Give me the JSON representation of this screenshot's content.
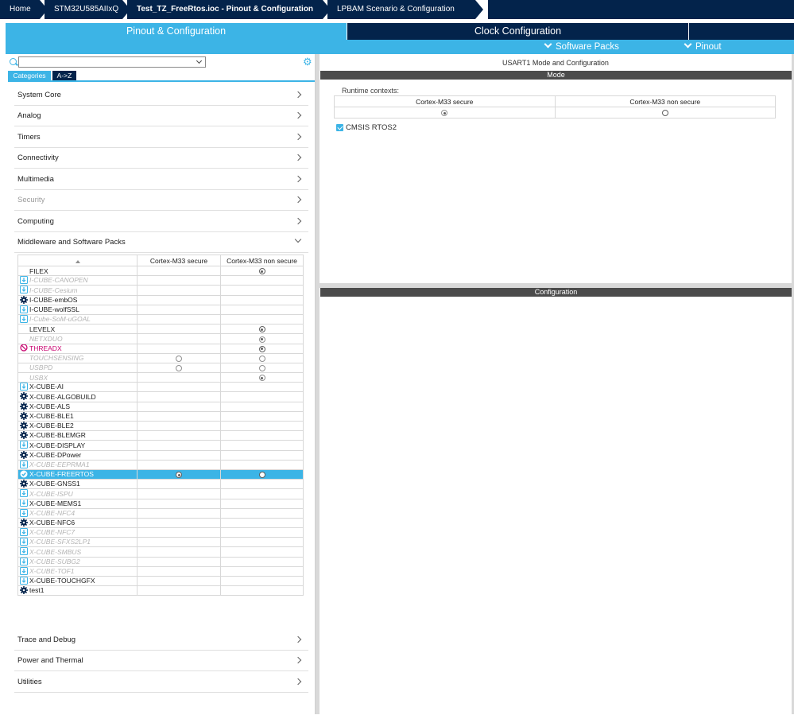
{
  "breadcrumb": [
    {
      "label": "Home",
      "active": false
    },
    {
      "label": "STM32U585AIIxQ",
      "active": false
    },
    {
      "label": "Test_TZ_FreeRtos.ioc - Pinout & Configuration",
      "active": true
    },
    {
      "label": "LPBAM Scenario & Configuration",
      "active": false
    }
  ],
  "tabs": {
    "pinout": "Pinout & Configuration",
    "clock": "Clock Configuration"
  },
  "submenus": {
    "software_packs": "Software Packs",
    "pinout": "Pinout"
  },
  "left": {
    "search_value": "",
    "view_tabs": {
      "categories": "Categories",
      "az": "A->Z"
    },
    "categories": [
      {
        "label": "System Core",
        "disabled": false
      },
      {
        "label": "Analog",
        "disabled": false
      },
      {
        "label": "Timers",
        "disabled": false
      },
      {
        "label": "Connectivity",
        "disabled": false
      },
      {
        "label": "Multimedia",
        "disabled": false
      },
      {
        "label": "Security",
        "disabled": true
      },
      {
        "label": "Computing",
        "disabled": false
      },
      {
        "label": "Middleware and Software Packs",
        "disabled": false,
        "expanded": true
      }
    ],
    "bottom_categories": [
      {
        "label": "Trace and Debug"
      },
      {
        "label": "Power and Thermal"
      },
      {
        "label": "Utilities"
      }
    ],
    "middleware_table": {
      "columns": [
        "Cortex-M33 secure",
        "Cortex-M33 non secure"
      ],
      "rows": [
        {
          "name": "FILEX",
          "icon": "none",
          "disabled": false,
          "secure": "",
          "nonsecure": "on"
        },
        {
          "name": "I-CUBE-CANOPEN",
          "icon": "download",
          "disabled": true,
          "secure": "",
          "nonsecure": ""
        },
        {
          "name": "I-CUBE-Cesium",
          "icon": "download",
          "disabled": true,
          "secure": "",
          "nonsecure": ""
        },
        {
          "name": "I-CUBE-embOS",
          "icon": "gear",
          "disabled": false,
          "secure": "",
          "nonsecure": ""
        },
        {
          "name": "I-CUBE-wolfSSL",
          "icon": "download",
          "disabled": false,
          "secure": "",
          "nonsecure": ""
        },
        {
          "name": "I-Cube-SoM-uGOAL",
          "icon": "download",
          "disabled": true,
          "secure": "",
          "nonsecure": ""
        },
        {
          "name": "LEVELX",
          "icon": "none",
          "disabled": false,
          "secure": "",
          "nonsecure": "on"
        },
        {
          "name": "NETXDUO",
          "icon": "none",
          "disabled": true,
          "secure": "",
          "nonsecure": "on"
        },
        {
          "name": "THREADX",
          "icon": "blocked",
          "disabled": false,
          "warn": true,
          "secure": "",
          "nonsecure": "on"
        },
        {
          "name": "TOUCHSENSING",
          "icon": "none",
          "disabled": true,
          "secure": "off",
          "nonsecure": "off"
        },
        {
          "name": "USBPD",
          "icon": "none",
          "disabled": true,
          "secure": "off",
          "nonsecure": "off"
        },
        {
          "name": "USBX",
          "icon": "none",
          "disabled": true,
          "secure": "",
          "nonsecure": "on"
        },
        {
          "name": "X-CUBE-AI",
          "icon": "download",
          "disabled": false,
          "secure": "",
          "nonsecure": ""
        },
        {
          "name": "X-CUBE-ALGOBUILD",
          "icon": "gear",
          "disabled": false,
          "secure": "",
          "nonsecure": ""
        },
        {
          "name": "X-CUBE-ALS",
          "icon": "gear",
          "disabled": false,
          "secure": "",
          "nonsecure": ""
        },
        {
          "name": "X-CUBE-BLE1",
          "icon": "gear",
          "disabled": false,
          "secure": "",
          "nonsecure": ""
        },
        {
          "name": "X-CUBE-BLE2",
          "icon": "gear",
          "disabled": false,
          "secure": "",
          "nonsecure": ""
        },
        {
          "name": "X-CUBE-BLEMGR",
          "icon": "gear",
          "disabled": false,
          "secure": "",
          "nonsecure": ""
        },
        {
          "name": "X-CUBE-DISPLAY",
          "icon": "download",
          "disabled": false,
          "secure": "",
          "nonsecure": ""
        },
        {
          "name": "X-CUBE-DPower",
          "icon": "gear",
          "disabled": false,
          "secure": "",
          "nonsecure": ""
        },
        {
          "name": "X-CUBE-EEPRMA1",
          "icon": "download",
          "disabled": true,
          "secure": "",
          "nonsecure": ""
        },
        {
          "name": "X-CUBE-FREERTOS",
          "icon": "check",
          "disabled": false,
          "selected": true,
          "secure": "on",
          "nonsecure": "off"
        },
        {
          "name": "X-CUBE-GNSS1",
          "icon": "gear",
          "disabled": false,
          "secure": "",
          "nonsecure": ""
        },
        {
          "name": "X-CUBE-ISPU",
          "icon": "download",
          "disabled": true,
          "secure": "",
          "nonsecure": ""
        },
        {
          "name": "X-CUBE-MEMS1",
          "icon": "download",
          "disabled": false,
          "secure": "",
          "nonsecure": ""
        },
        {
          "name": "X-CUBE-NFC4",
          "icon": "download",
          "disabled": true,
          "secure": "",
          "nonsecure": ""
        },
        {
          "name": "X-CUBE-NFC6",
          "icon": "gear",
          "disabled": false,
          "secure": "",
          "nonsecure": ""
        },
        {
          "name": "X-CUBE-NFC7",
          "icon": "download",
          "disabled": true,
          "secure": "",
          "nonsecure": ""
        },
        {
          "name": "X-CUBE-SFXS2LP1",
          "icon": "download",
          "disabled": true,
          "secure": "",
          "nonsecure": ""
        },
        {
          "name": "X-CUBE-SMBUS",
          "icon": "download",
          "disabled": true,
          "secure": "",
          "nonsecure": ""
        },
        {
          "name": "X-CUBE-SUBG2",
          "icon": "download",
          "disabled": true,
          "secure": "",
          "nonsecure": ""
        },
        {
          "name": "X-CUBE-TOF1",
          "icon": "download",
          "disabled": true,
          "secure": "",
          "nonsecure": ""
        },
        {
          "name": "X-CUBE-TOUCHGFX",
          "icon": "download",
          "disabled": false,
          "secure": "",
          "nonsecure": ""
        },
        {
          "name": "test1",
          "icon": "gear",
          "disabled": false,
          "secure": "",
          "nonsecure": ""
        }
      ]
    }
  },
  "right": {
    "title": "USART1 Mode and Configuration",
    "mode_header": "Mode",
    "runtime_label": "Runtime contexts:",
    "runtime_columns": [
      "Cortex-M33 secure",
      "Cortex-M33 non secure"
    ],
    "runtime_values": [
      "on",
      "off"
    ],
    "checkbox_label": "CMSIS RTOS2",
    "checkbox_checked": true,
    "config_header": "Configuration"
  },
  "colors": {
    "accent": "#3cb4e6",
    "navy": "#03234b",
    "warn": "#c8006e"
  }
}
